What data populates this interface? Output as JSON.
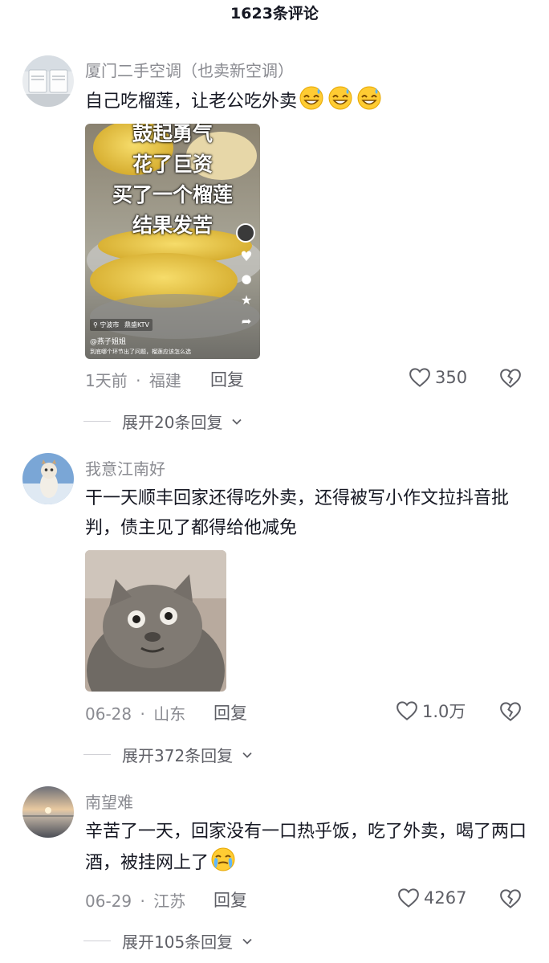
{
  "header": {
    "title": "1623条评论"
  },
  "comments": [
    {
      "username": "厦门二手空调（也卖新空调）",
      "text": "自己吃榴莲，让老公吃外卖",
      "emojis": [
        "grin-sweat-emoji",
        "grin-sweat-emoji",
        "grin-sweat-emoji"
      ],
      "image": {
        "overlay_lines": [
          "鼓起勇气",
          "花了巨资",
          "买了一个榴莲",
          "结果发苦"
        ],
        "location_tag": "宁波市",
        "location_tag2": "鼎盛KTV",
        "author_tag": "@燕子姐姐",
        "caption": "到底哪个环节出了问题，榴莲应该怎么选"
      },
      "time": "1天前",
      "region": "福建",
      "reply_label": "回复",
      "likes": "350",
      "expand_label": "展开20条回复"
    },
    {
      "username": "我意江南好",
      "text": "干一天顺丰回家还得吃外卖，还得被写小作文拉抖音批判，债主见了都得给他减免",
      "time": "06-28",
      "region": "山东",
      "reply_label": "回复",
      "likes": "1.0万",
      "expand_label": "展开372条回复"
    },
    {
      "username": "南望难",
      "text": "辛苦了一天，回家没有一口热乎饭，吃了外卖，喝了两口酒，被挂网上了",
      "emojis": [
        "crying-emoji"
      ],
      "time": "06-29",
      "region": "江苏",
      "reply_label": "回复",
      "likes": "4267",
      "expand_label": "展开105条回复"
    }
  ],
  "separator": "·"
}
